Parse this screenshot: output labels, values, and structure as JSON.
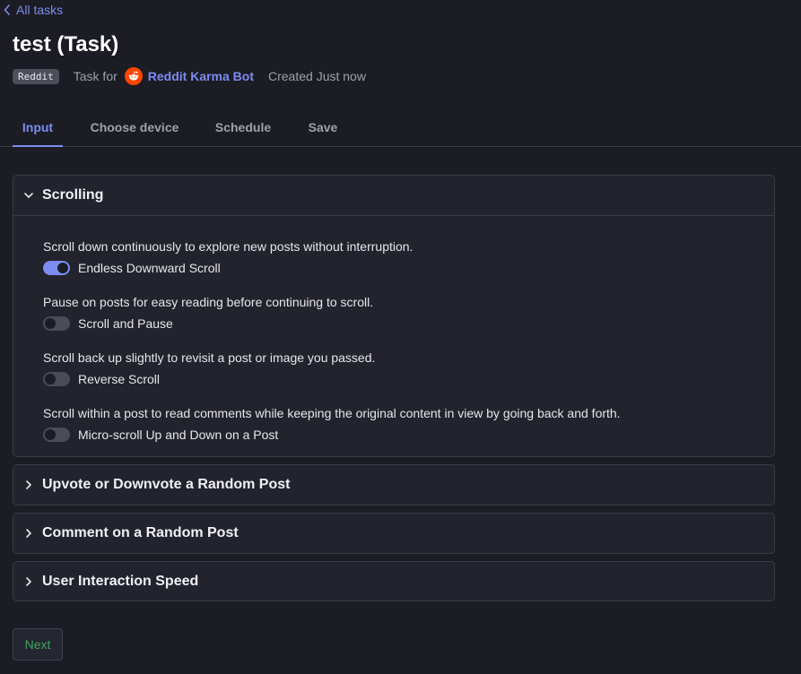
{
  "nav": {
    "back_label": "All tasks"
  },
  "header": {
    "title": "test (Task)",
    "platform_badge": "Reddit",
    "task_for_label": "Task for",
    "bot_name": "Reddit Karma Bot",
    "created_text": "Created Just now"
  },
  "tabs": [
    {
      "label": "Input",
      "active": true
    },
    {
      "label": "Choose device",
      "active": false
    },
    {
      "label": "Schedule",
      "active": false
    },
    {
      "label": "Save",
      "active": false
    }
  ],
  "sections": {
    "scrolling": {
      "title": "Scrolling",
      "expanded": true,
      "options": [
        {
          "description": "Scroll down continuously to explore new posts without interruption.",
          "label": "Endless Downward Scroll",
          "enabled": true
        },
        {
          "description": "Pause on posts for easy reading before continuing to scroll.",
          "label": "Scroll and Pause",
          "enabled": false
        },
        {
          "description": "Scroll back up slightly to revisit a post or image you passed.",
          "label": "Reverse Scroll",
          "enabled": false
        },
        {
          "description": "Scroll within a post to read comments while keeping the original content in view by going back and forth.",
          "label": "Micro-scroll Up and Down on a Post",
          "enabled": false
        }
      ]
    },
    "vote": {
      "title": "Upvote or Downvote a Random Post",
      "expanded": false
    },
    "comment": {
      "title": "Comment on a Random Post",
      "expanded": false
    },
    "speed": {
      "title": "User Interaction Speed",
      "expanded": false
    }
  },
  "footer": {
    "next_label": "Next"
  },
  "colors": {
    "accent": "#7d8cf0",
    "reddit_orange": "#ff4500",
    "next_green": "#3ea55f",
    "background": "#1b1c24"
  },
  "icons": {
    "back": "chevron-left-icon",
    "expanded": "chevron-down-icon",
    "collapsed": "chevron-right-icon",
    "bot": "reddit-logo-icon"
  }
}
